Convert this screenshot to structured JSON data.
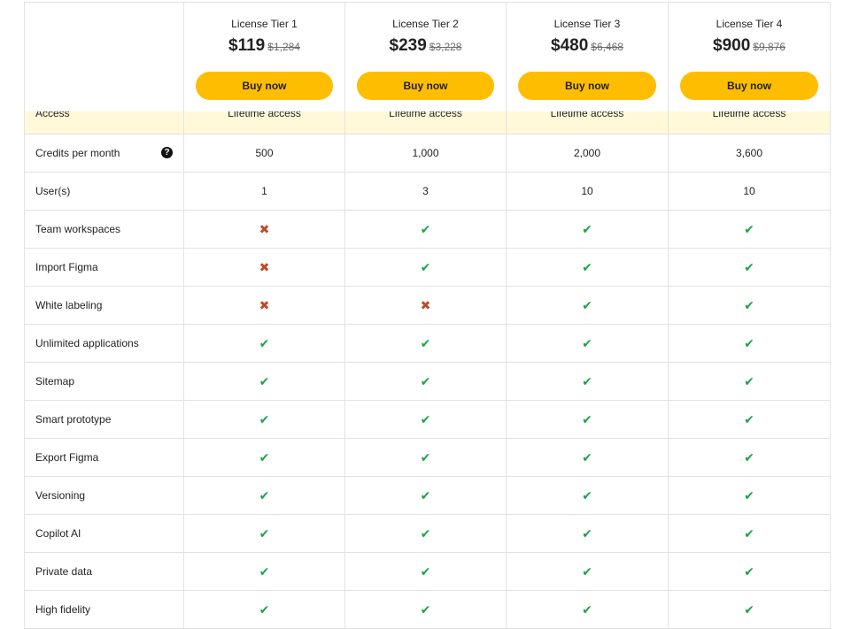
{
  "tiers": [
    {
      "name": "License Tier 1",
      "price": "$119",
      "old_price": "$1,284",
      "button": "Buy now"
    },
    {
      "name": "License Tier 2",
      "price": "$239",
      "old_price": "$3,228",
      "button": "Buy now"
    },
    {
      "name": "License Tier 3",
      "price": "$480",
      "old_price": "$6,468",
      "button": "Buy now"
    },
    {
      "name": "License Tier 4",
      "price": "$900",
      "old_price": "$9,876",
      "button": "Buy now"
    }
  ],
  "access": {
    "label": "Access",
    "values": [
      "Lifetime access",
      "Lifetime access",
      "Lifetime access",
      "Lifetime access"
    ]
  },
  "rows": [
    {
      "label": "Credits per month",
      "help": "?",
      "values": [
        "500",
        "1,000",
        "2,000",
        "3,600"
      ]
    },
    {
      "label": "User(s)",
      "values": [
        "1",
        "3",
        "10",
        "10"
      ]
    },
    {
      "label": "Team workspaces",
      "values": [
        false,
        true,
        true,
        true
      ]
    },
    {
      "label": "Import Figma",
      "values": [
        false,
        true,
        true,
        true
      ]
    },
    {
      "label": "White labeling",
      "values": [
        false,
        false,
        true,
        true
      ]
    },
    {
      "label": "Unlimited applications",
      "values": [
        true,
        true,
        true,
        true
      ]
    },
    {
      "label": "Sitemap",
      "values": [
        true,
        true,
        true,
        true
      ]
    },
    {
      "label": "Smart prototype",
      "values": [
        true,
        true,
        true,
        true
      ]
    },
    {
      "label": "Export Figma",
      "values": [
        true,
        true,
        true,
        true
      ]
    },
    {
      "label": "Versioning",
      "values": [
        true,
        true,
        true,
        true
      ]
    },
    {
      "label": "Copilot AI",
      "values": [
        true,
        true,
        true,
        true
      ]
    },
    {
      "label": "Private data",
      "values": [
        true,
        true,
        true,
        true
      ]
    },
    {
      "label": "High fidelity",
      "values": [
        true,
        true,
        true,
        true
      ]
    }
  ],
  "icons": {
    "included": "check-icon",
    "excluded": "cross-icon"
  },
  "colors": {
    "button": "#ffbd00",
    "access_band": "#fff9d9",
    "check": "#1fa34a",
    "cross": "#c0492a"
  }
}
